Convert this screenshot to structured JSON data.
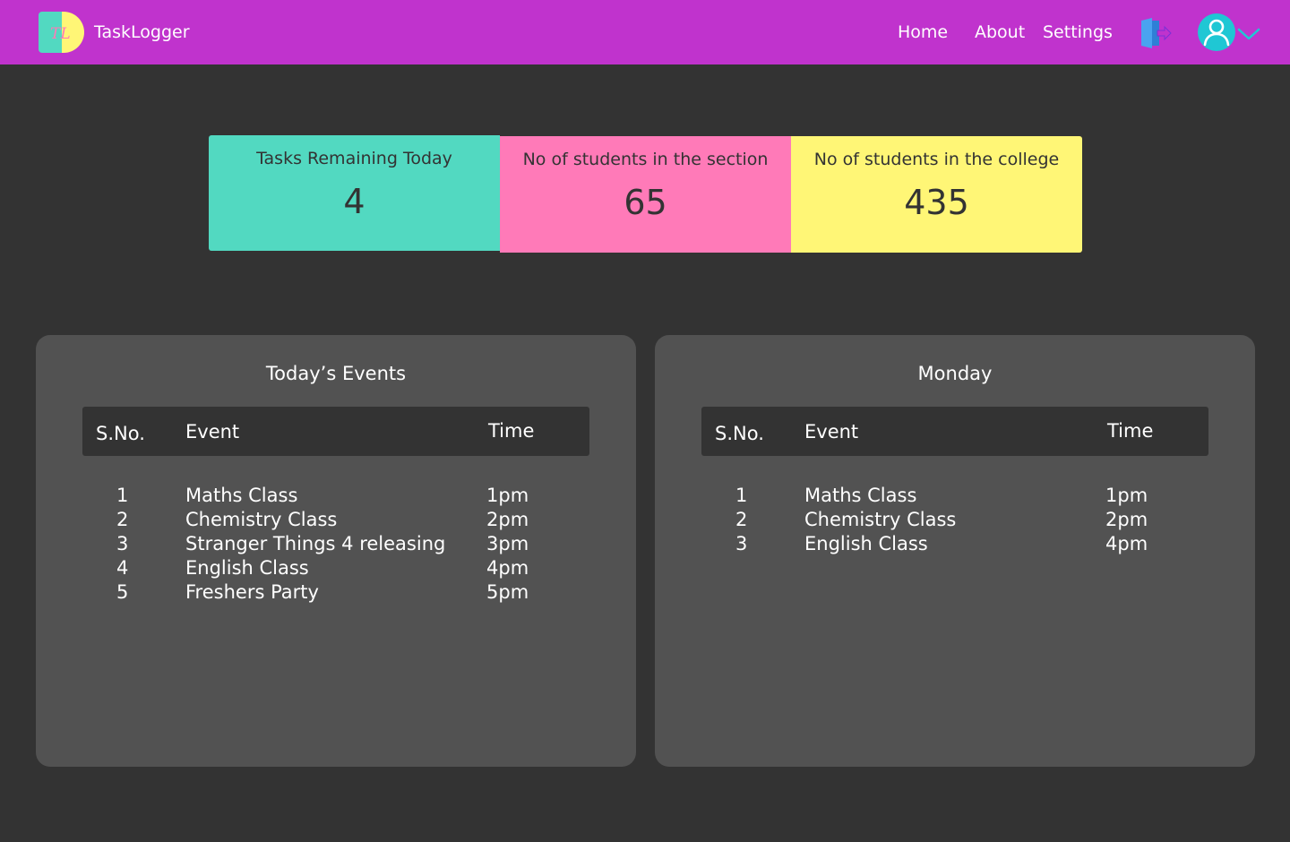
{
  "app": {
    "logo_text": "TL",
    "brand": "TaskLogger"
  },
  "nav": {
    "home": "Home",
    "about": "About",
    "settings": "Settings"
  },
  "colors": {
    "navbar": "#c033cd",
    "background": "#333333",
    "panel": "#525252",
    "card_tasks": "#52d9c1",
    "card_section": "#ff7ab8",
    "card_college": "#fff676",
    "accent_icon": "#1fc7d4"
  },
  "stats": [
    {
      "label": "Tasks Remaining Today",
      "value": "4"
    },
    {
      "label": "No of students in the section",
      "value": "65"
    },
    {
      "label": "No of students in the college",
      "value": "435"
    }
  ],
  "today": {
    "title": "Today’s Events",
    "headers": {
      "sno": "S.No.",
      "event": "Event",
      "time": "Time"
    },
    "rows": [
      {
        "sno": "1",
        "event": "Maths Class",
        "time": "1pm"
      },
      {
        "sno": "2",
        "event": "Chemistry Class",
        "time": "2pm"
      },
      {
        "sno": "3",
        "event": "Stranger Things 4 releasing",
        "time": "3pm"
      },
      {
        "sno": "4",
        "event": "English Class",
        "time": "4pm"
      },
      {
        "sno": "5",
        "event": "Freshers Party",
        "time": "5pm"
      }
    ]
  },
  "monday": {
    "title": "Monday",
    "headers": {
      "sno": "S.No.",
      "event": "Event",
      "time": "Time"
    },
    "rows": [
      {
        "sno": "1",
        "event": "Maths Class",
        "time": "1pm"
      },
      {
        "sno": "2",
        "event": "Chemistry Class",
        "time": "2pm"
      },
      {
        "sno": "3",
        "event": "English Class",
        "time": "4pm"
      }
    ]
  }
}
